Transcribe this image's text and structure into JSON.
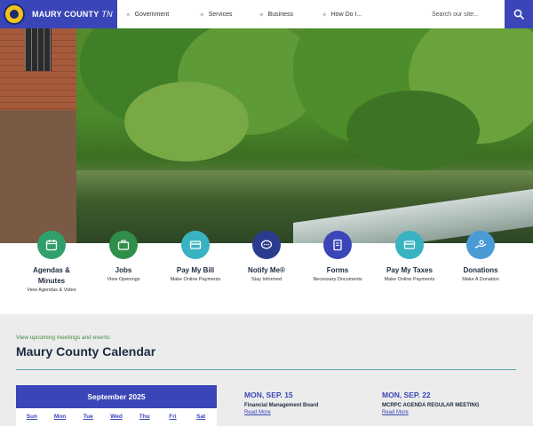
{
  "header": {
    "site_name": "MAURY COUNTY",
    "site_state": "TN",
    "nav": [
      "Government",
      "Services",
      "Business",
      "How Do I..."
    ],
    "search_placeholder": "Search our site..."
  },
  "quick_links": [
    {
      "title": "Agendas &",
      "title2": "Minutes",
      "sub": "View Agendas & Video",
      "icon": "calendar-icon",
      "color": "#2fa06b"
    },
    {
      "title": "Jobs",
      "sub": "View Openings",
      "icon": "briefcase-icon",
      "color": "#2f8f4a"
    },
    {
      "title": "Pay My Bill",
      "sub": "Make Online Payments",
      "icon": "credit-card-icon",
      "color": "#39b3c1"
    },
    {
      "title": "Notify Me®",
      "sub": "Stay Informed",
      "icon": "chat-bubble-icon",
      "color": "#2b3c8f"
    },
    {
      "title": "Forms",
      "sub": "Necessary Documents",
      "icon": "document-icon",
      "color": "#3a46b8"
    },
    {
      "title": "Pay My Taxes",
      "sub": "Make Online Payments",
      "icon": "credit-card-icon",
      "color": "#39b3c1"
    },
    {
      "title": "Donations",
      "sub": "Make A Donation",
      "icon": "donation-hand-icon",
      "color": "#4a9ad6"
    }
  ],
  "calendar": {
    "kicker": "View upcoming meetings and events",
    "title": "Maury County Calendar",
    "month": "September 2025",
    "days": [
      "Sun",
      "Mon",
      "Tue",
      "Wed",
      "Thu",
      "Fri",
      "Sat"
    ]
  },
  "events": [
    {
      "date": "MON, SEP. 15",
      "name": "Financial Management Board",
      "more": "Read More"
    },
    {
      "date": "MON, SEP. 22",
      "name": "MCRPC AGENDA REGULAR MEETING",
      "more": "Read More"
    }
  ],
  "colors": {
    "brand": "#3a46b8",
    "heading": "#1d2a40",
    "kicker": "#3d8a3d"
  }
}
